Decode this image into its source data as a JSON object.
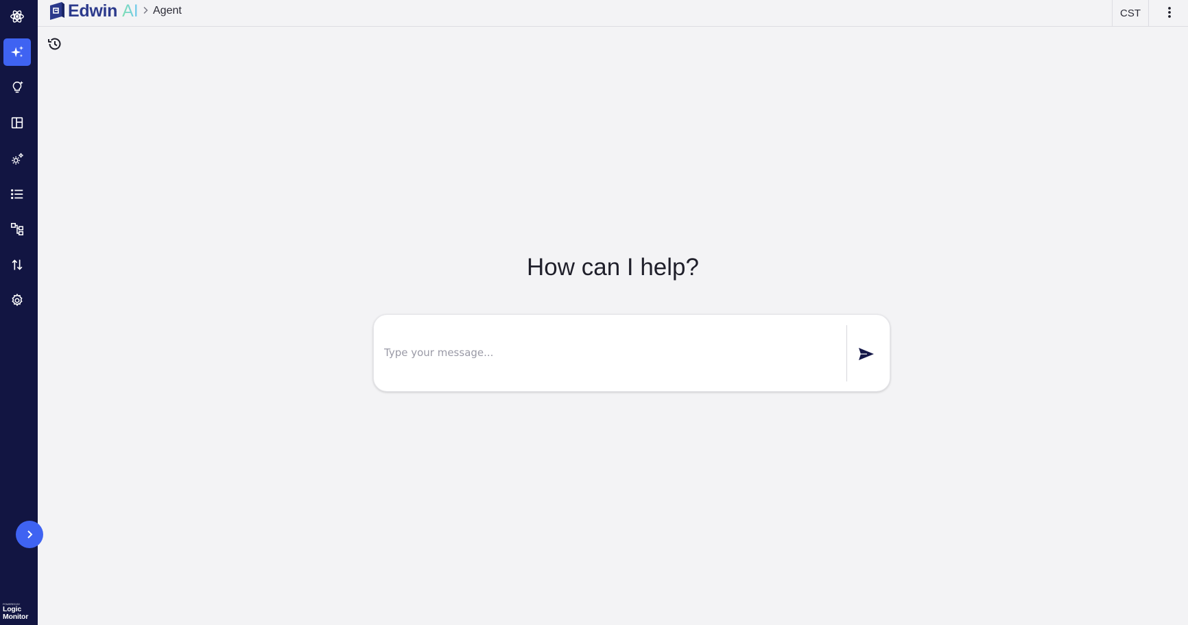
{
  "header": {
    "brand_name": "Edwin",
    "brand_suffix": "AI",
    "breadcrumb_page": "Agent",
    "timezone": "CST"
  },
  "sidebar": {
    "items": [
      {
        "icon": "atom-icon",
        "active": false
      },
      {
        "icon": "sparkles-icon",
        "active": true
      },
      {
        "icon": "lightbulb-icon",
        "active": false
      },
      {
        "icon": "dashboard-layout-icon",
        "active": false
      },
      {
        "icon": "gear-cluster-icon",
        "active": false
      },
      {
        "icon": "list-icon",
        "active": false
      },
      {
        "icon": "hierarchy-icon",
        "active": false
      },
      {
        "icon": "sort-arrows-icon",
        "active": false
      },
      {
        "icon": "settings-gear-icon",
        "active": false
      }
    ],
    "logo_tagline": "POWERED BY",
    "logo_line1": "Logic",
    "logo_line2": "Monitor"
  },
  "main": {
    "heading": "How can I help?",
    "message_placeholder": "Type your message..."
  },
  "colors": {
    "rail_bg": "#121542",
    "accent": "#3f63f2",
    "page_bg": "#f3f3f5",
    "brand_text": "#2c3a8c"
  }
}
